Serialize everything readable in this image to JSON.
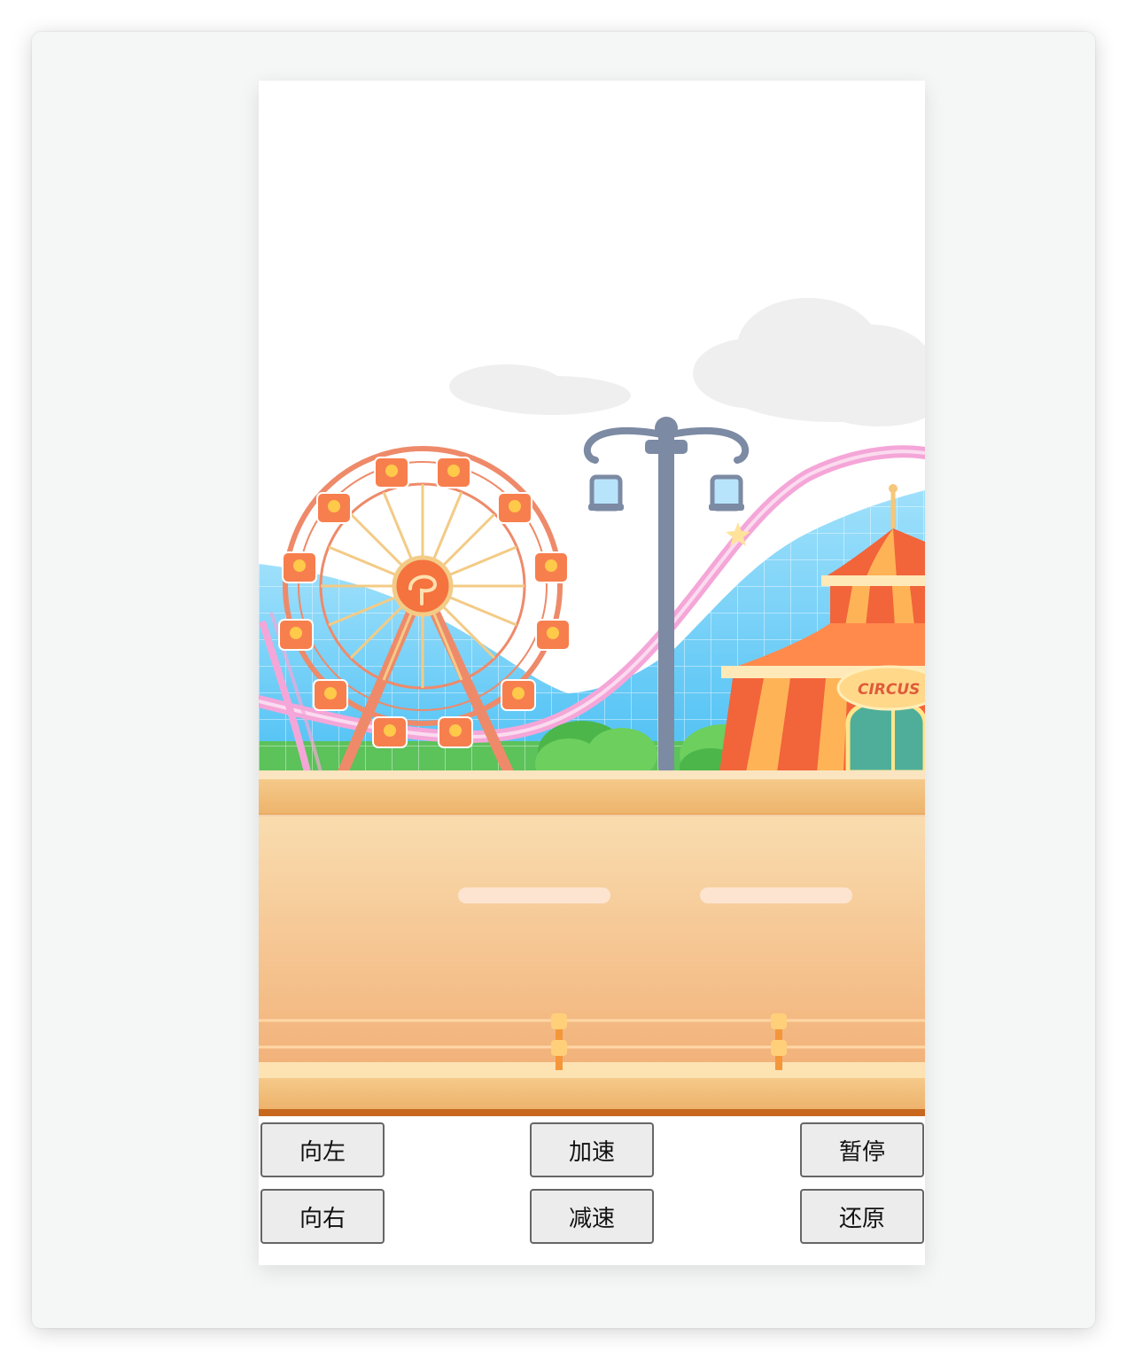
{
  "scene": {
    "circus_sign": "CIRCUS",
    "colors": {
      "road_top": "#f9dcae",
      "road_bottom": "#f2b27a",
      "road_edge": "#c8681e",
      "ferris_wheel": "#ee8a6a",
      "tent_red": "#f2643a",
      "tent_orange": "#ffb357",
      "sky_grid": "#5ec7f4",
      "coaster_track": "#f5a6d8",
      "lamp_post": "#7c8aa3",
      "grass": "#5cc25a"
    }
  },
  "controls": {
    "left": "向左",
    "accelerate": "加速",
    "pause": "暂停",
    "right": "向右",
    "decelerate": "减速",
    "reset": "还原"
  }
}
